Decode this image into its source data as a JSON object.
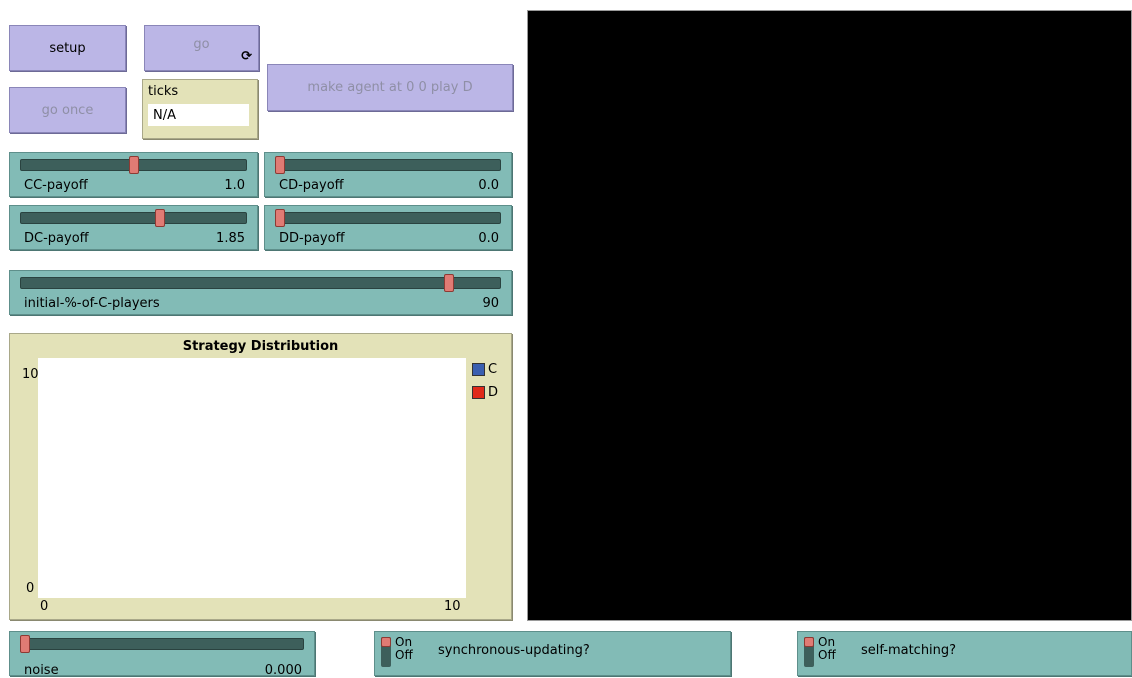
{
  "buttons": {
    "setup": "setup",
    "go": "go",
    "go_forever_icon": "⟳",
    "go_once": "go once",
    "make_agent": "make agent at 0 0 play D"
  },
  "monitor": {
    "label": "ticks",
    "value": "N/A"
  },
  "sliders": {
    "cc": {
      "label": "CC-payoff",
      "value": "1.0",
      "fraction": 0.5
    },
    "cd": {
      "label": "CD-payoff",
      "value": "0.0",
      "fraction": 0.0
    },
    "dc": {
      "label": "DC-payoff",
      "value": "1.85",
      "fraction": 0.62
    },
    "dd": {
      "label": "DD-payoff",
      "value": "0.0",
      "fraction": 0.0
    },
    "initial": {
      "label": "initial-%-of-C-players",
      "value": "90",
      "fraction": 0.9
    },
    "noise": {
      "label": "noise",
      "value": "0.000",
      "fraction": 0.0
    }
  },
  "plot": {
    "title": "Strategy Distribution",
    "y_max": "10",
    "y_min": "0",
    "x_min": "0",
    "x_max": "10",
    "legend": [
      {
        "name": "C",
        "color": "#3a5fb0"
      },
      {
        "name": "D",
        "color": "#e02a1a"
      }
    ]
  },
  "chart_data": {
    "type": "line",
    "title": "Strategy Distribution",
    "xlim": [
      0,
      10
    ],
    "ylim": [
      0,
      10
    ],
    "series": [
      {
        "name": "C",
        "values": []
      },
      {
        "name": "D",
        "values": []
      }
    ]
  },
  "switches": {
    "synchronous": {
      "on": "On",
      "off": "Off",
      "label": "synchronous-updating?",
      "state": "off"
    },
    "self_matching": {
      "on": "On",
      "off": "Off",
      "label": "self-matching?",
      "state": "off"
    }
  }
}
